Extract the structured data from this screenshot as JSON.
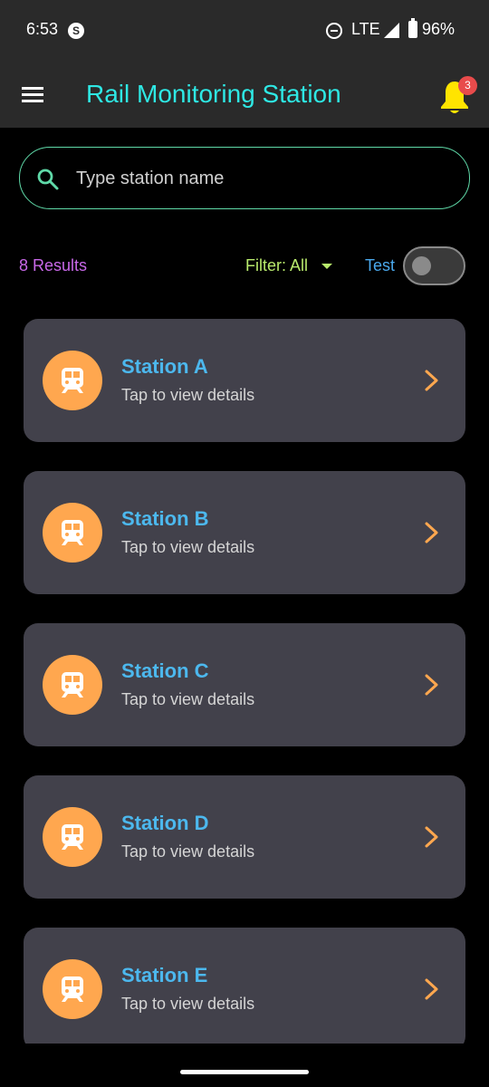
{
  "status_bar": {
    "time": "6:53",
    "app_icon": "S",
    "network": "LTE",
    "battery": "96%"
  },
  "app_bar": {
    "title": "Rail Monitoring Station",
    "notification_count": "3"
  },
  "search": {
    "placeholder": "Type station name",
    "value": ""
  },
  "filters": {
    "results": "8 Results",
    "filter_label": "Filter: All",
    "test_label": "Test",
    "test_on": false
  },
  "stations": [
    {
      "name": "Station A",
      "subtitle": "Tap to view details"
    },
    {
      "name": "Station B",
      "subtitle": "Tap to view details"
    },
    {
      "name": "Station C",
      "subtitle": "Tap to view details"
    },
    {
      "name": "Station D",
      "subtitle": "Tap to view details"
    },
    {
      "name": "Station E",
      "subtitle": "Tap to view details"
    }
  ],
  "colors": {
    "title": "#2ee8e4",
    "bell": "#ffe400",
    "badge": "#e84b4b",
    "search_border": "#5fd9a8",
    "results": "#c868e8",
    "filter": "#b8ea6c",
    "test": "#4aa8ec",
    "card": "#42414b",
    "avatar": "#ffa74f",
    "station_name": "#4cb8ee",
    "chevron": "#ffa74f"
  },
  "icons": {
    "menu": "menu-icon",
    "bell": "bell-icon",
    "search": "search-icon",
    "train": "train-icon",
    "chevron": "chevron-right-icon"
  }
}
